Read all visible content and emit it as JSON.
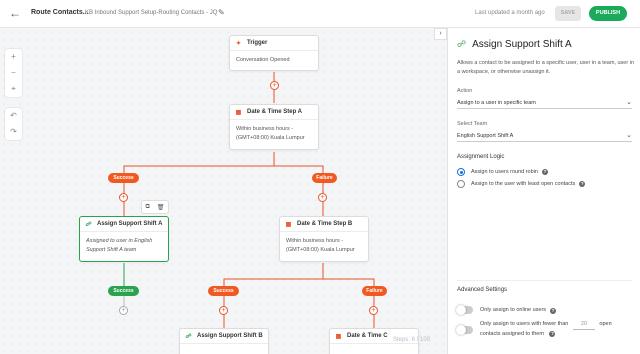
{
  "header": {
    "back_icon": "arrow-left-icon",
    "title": "Route Contacts...",
    "subtitle": "KB Inbound Support Setup-Routing Contacts - JQ",
    "edit_icon": "pencil-icon",
    "updated": "Last updated a month ago",
    "save_label": "SAVE",
    "publish_label": "PUBLISH",
    "colors": {
      "publish": "#1aaa5a",
      "success": "#2ba24c",
      "failure": "#f05a22"
    }
  },
  "canvas": {
    "tools": {
      "zoom_in": "+",
      "zoom_out": "−",
      "fit": "⌖",
      "undo": "↶",
      "redo": "↷"
    },
    "collapse": "›",
    "trigger": {
      "title": "Trigger",
      "body": "Conversation Opened"
    },
    "date_a": {
      "title": "Date & Time Step A",
      "body1": "Within business hours -",
      "body2": "(GMT+08:00) Kuala Lumpur"
    },
    "assign_a": {
      "title": "Assign Support Shift A",
      "body1": "Assigned to user in English",
      "body2": "Support Shift A team"
    },
    "date_b": {
      "title": "Date & Time Step B",
      "body1": "Within business hours -",
      "body2": "(GMT+08:00) Kuala Lumpur"
    },
    "assign_b": {
      "title": "Assign Support Shift B"
    },
    "date_c": {
      "title": "Date & Time C"
    },
    "success": "Success",
    "failure": "Failure",
    "steps": "Steps: 6 / 100"
  },
  "panel": {
    "title": "Assign Support Shift A",
    "description": "Allows a contact to be assigned to a specific user, user in a team, user in a workspace, or otherwise unassign it.",
    "action_label": "Action",
    "action_value": "Assign to a user in specific team",
    "team_label": "Select Team",
    "team_value": "English Support Shift A",
    "logic_label": "Assignment Logic",
    "logic_option1": "Assign to users round robin",
    "logic_option2": "Assign to the user with least open contacts",
    "advanced_label": "Advanced Settings",
    "online_label": "Only assign to online users",
    "fewer_label_a": "Only assign to users with fewer than",
    "fewer_value": "20",
    "fewer_label_b": "open",
    "fewer_label_c": "contacts assigned to them"
  }
}
